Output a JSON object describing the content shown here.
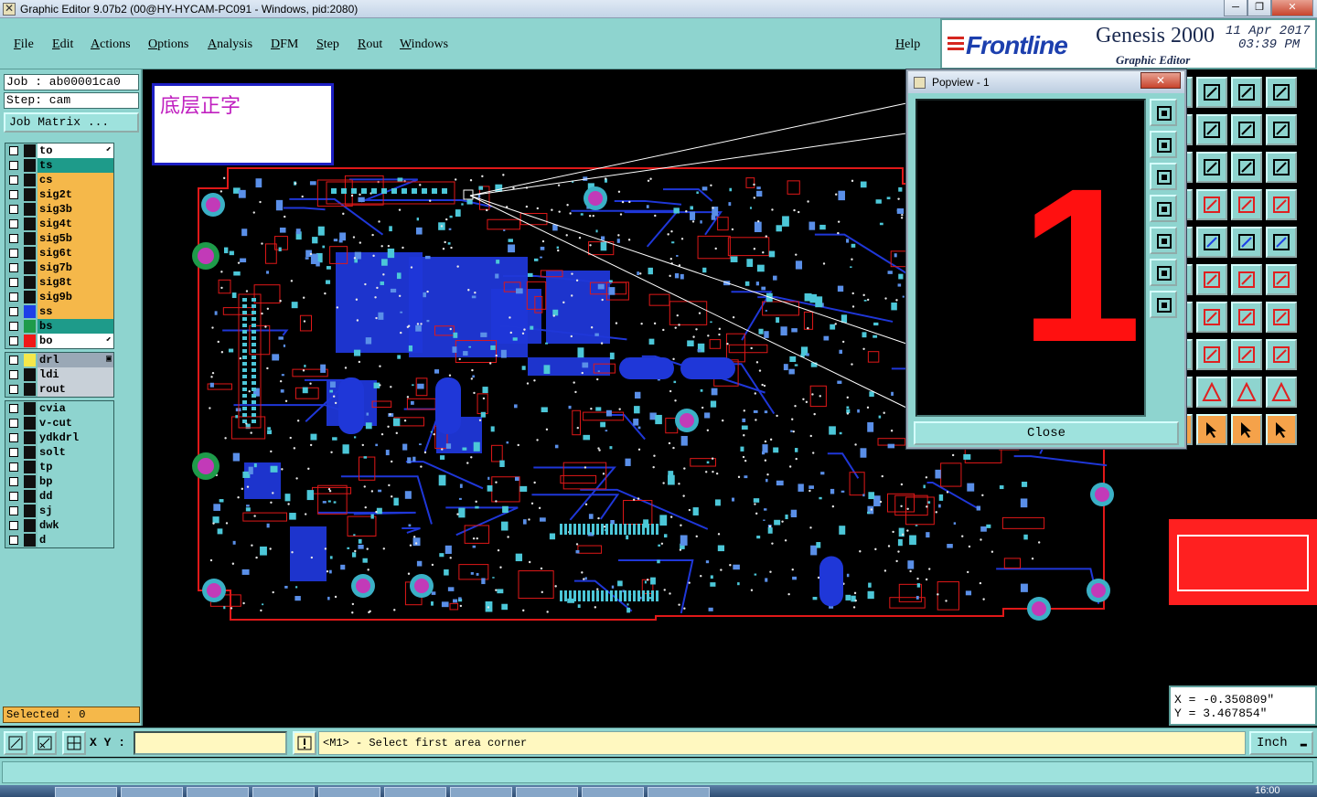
{
  "window": {
    "title": "Graphic Editor 9.07b2 (00@HY-HYCAM-PC091 - Windows, pid:2080)",
    "buttons": [
      "─",
      "❐",
      "✕"
    ]
  },
  "menu": {
    "items": [
      "File",
      "Edit",
      "Actions",
      "Options",
      "Analysis",
      "DFM",
      "Step",
      "Rout",
      "Windows"
    ],
    "help": "Help"
  },
  "brand": {
    "logo": "Frontline",
    "product": "Genesis 2000",
    "subtitle": "Graphic Editor",
    "date": "11 Apr 2017",
    "time": "03:39 PM"
  },
  "job": {
    "job": "Job : ab00001ca0",
    "step": "Step: cam",
    "matrix_button": "Job Matrix ..."
  },
  "layers": {
    "board": [
      {
        "name": "to",
        "color": "#101010",
        "bg": "#ffffff",
        "arrow": "⬋"
      },
      {
        "name": "ts",
        "color": "#101010",
        "bg": "#1e9b8a"
      },
      {
        "name": "cs",
        "color": "#101010",
        "bg": "#f5b84a"
      },
      {
        "name": "sig2t",
        "color": "#101010",
        "bg": "#f5b84a"
      },
      {
        "name": "sig3b",
        "color": "#101010",
        "bg": "#f5b84a"
      },
      {
        "name": "sig4t",
        "color": "#101010",
        "bg": "#f5b84a"
      },
      {
        "name": "sig5b",
        "color": "#101010",
        "bg": "#f5b84a"
      },
      {
        "name": "sig6t",
        "color": "#101010",
        "bg": "#f5b84a"
      },
      {
        "name": "sig7b",
        "color": "#101010",
        "bg": "#f5b84a"
      },
      {
        "name": "sig8t",
        "color": "#101010",
        "bg": "#f5b84a"
      },
      {
        "name": "sig9b",
        "color": "#101010",
        "bg": "#f5b84a"
      },
      {
        "name": "ss",
        "color": "#1d3fe8",
        "bg": "#f5b84a"
      },
      {
        "name": "bs",
        "color": "#1e9b4a",
        "bg": "#1e9b8a"
      },
      {
        "name": "bo",
        "color": "#f01818",
        "bg": "#ffffff",
        "arrow": "⬋"
      }
    ],
    "drill": [
      {
        "name": "drl",
        "color": "#f5e84a",
        "bg": "#9aa8b6",
        "arrow": "▣"
      },
      {
        "name": "ldi",
        "color": "#101010",
        "bg": "#c8d0d8"
      },
      {
        "name": "rout",
        "color": "#101010",
        "bg": "#c8d0d8"
      }
    ],
    "misc": [
      {
        "name": "cvia",
        "color": "#101010",
        "bg": "#8ed4cf"
      },
      {
        "name": "v-cut",
        "color": "#101010",
        "bg": "#8ed4cf"
      },
      {
        "name": "ydkdrl",
        "color": "#101010",
        "bg": "#8ed4cf"
      },
      {
        "name": "solt",
        "color": "#101010",
        "bg": "#8ed4cf"
      },
      {
        "name": "tp",
        "color": "#101010",
        "bg": "#8ed4cf"
      },
      {
        "name": "bp",
        "color": "#101010",
        "bg": "#8ed4cf"
      },
      {
        "name": "dd",
        "color": "#101010",
        "bg": "#8ed4cf"
      },
      {
        "name": "sj",
        "color": "#101010",
        "bg": "#8ed4cf"
      },
      {
        "name": "dwk",
        "color": "#101010",
        "bg": "#8ed4cf"
      },
      {
        "name": "d",
        "color": "#101010",
        "bg": "#8ed4cf"
      }
    ]
  },
  "selected": "Selected : 0",
  "canvas": {
    "note": "底层正字"
  },
  "popview": {
    "title": "Popview - 1",
    "close_x": "✕",
    "big_number": "1",
    "close_button": "Close"
  },
  "coords": {
    "x": "X = -0.350809\"",
    "y": "Y = 3.467854\""
  },
  "status": {
    "xy_label": "X Y :",
    "xy_value": "",
    "message": "<M1> - Select first area corner",
    "units": "Inch",
    "units_dd": "▬"
  },
  "taskbar": {
    "clock": "16:00"
  }
}
